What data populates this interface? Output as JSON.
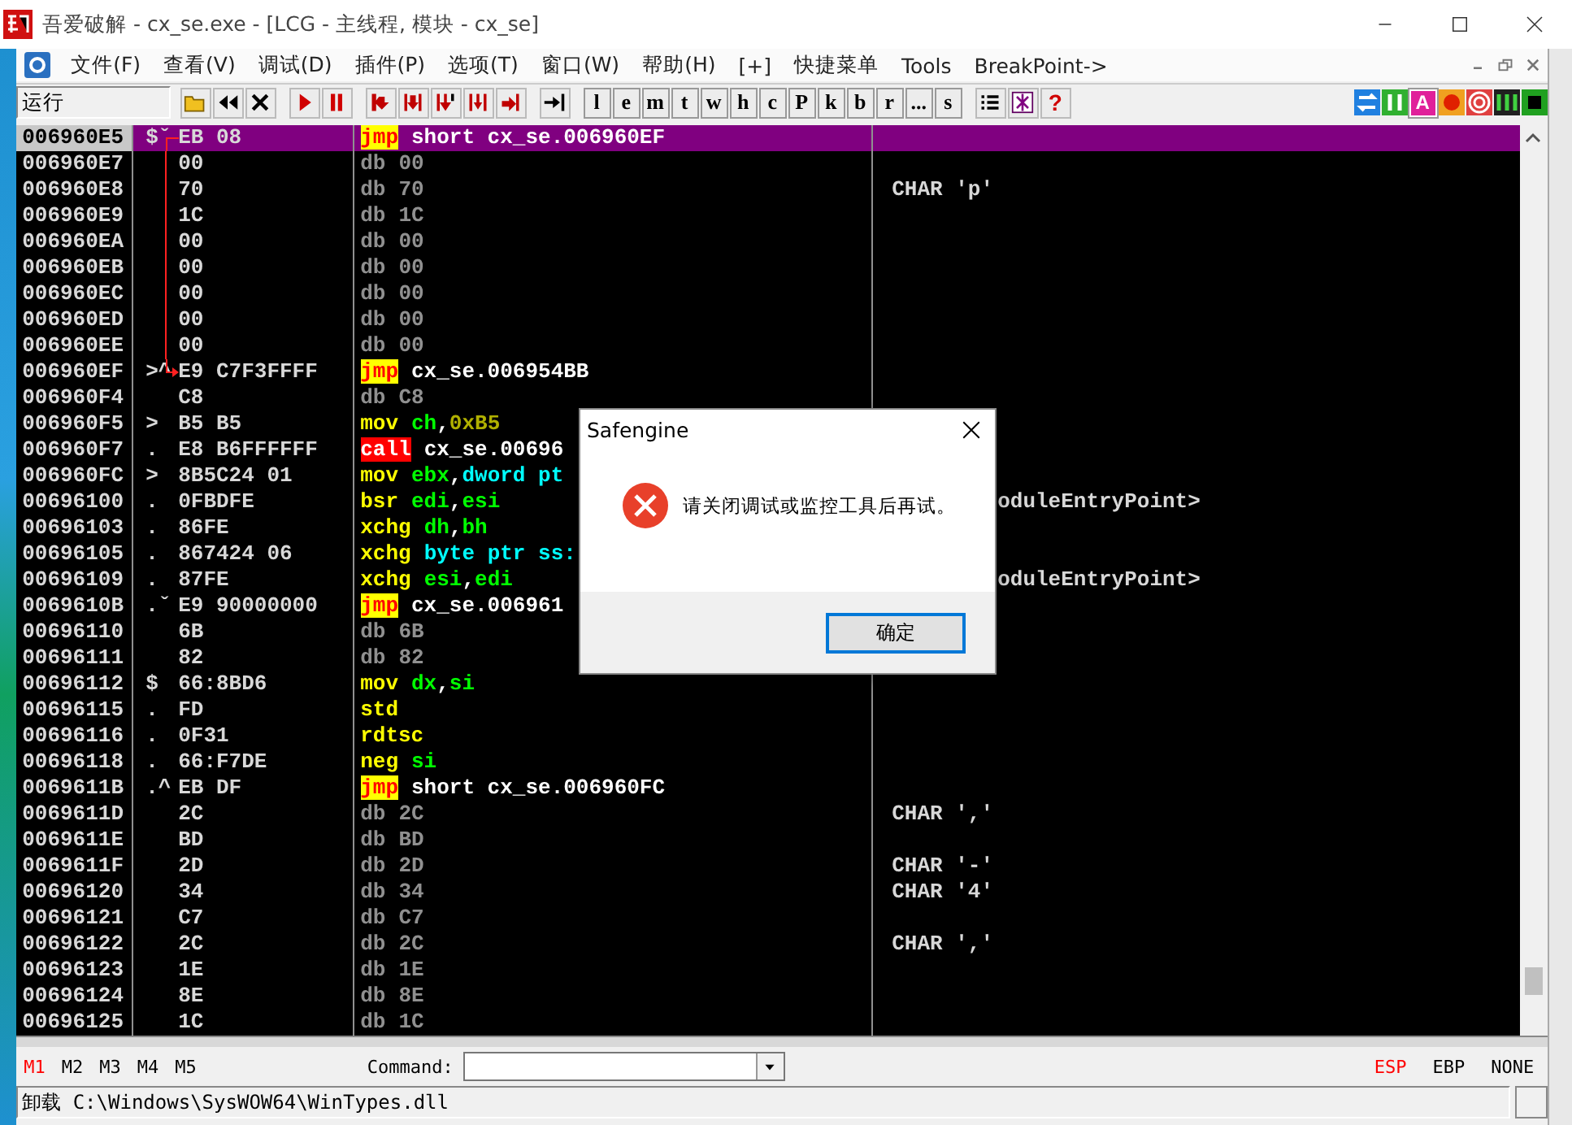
{
  "window": {
    "title": "吾爱破解 - cx_se.exe - [LCG -  主线程, 模块 - cx_se]"
  },
  "menu": [
    "文件(F)",
    "查看(V)",
    "调试(D)",
    "插件(P)",
    "选项(T)",
    "窗口(W)",
    "帮助(H)",
    "[+]",
    "快捷菜单",
    "Tools",
    "BreakPoint->"
  ],
  "toolbar": {
    "status": "运行",
    "letter_buttons": [
      "l",
      "e",
      "m",
      "t",
      "w",
      "h",
      "c",
      "P",
      "k",
      "b",
      "r",
      "...",
      "s"
    ],
    "help_button": "?",
    "letter_icon": "A"
  },
  "disassembly": {
    "rows": [
      {
        "address": "006960E5",
        "marker": "$ˇ",
        "hex": "EB 08",
        "mnemonic": {
          "text": "jmp",
          "kind": "jump"
        },
        "operands": [
          {
            "text": "short cx_se.006960EF",
            "kind": "label"
          }
        ],
        "selected": true,
        "jump": {
          "kind": "start"
        }
      },
      {
        "address": "006960E7",
        "hex": "00",
        "mnemonic": {
          "text": "db",
          "kind": "data"
        },
        "operands": [
          {
            "text": "00",
            "kind": "data"
          }
        ],
        "selected": false,
        "jump": {
          "kind": "through"
        }
      },
      {
        "address": "006960E8",
        "hex": "70",
        "mnemonic": {
          "text": "db",
          "kind": "data"
        },
        "operands": [
          {
            "text": "70",
            "kind": "data"
          }
        ],
        "comment": "CHAR 'p'",
        "selected": false,
        "jump": {
          "kind": "through"
        }
      },
      {
        "address": "006960E9",
        "hex": "1C",
        "mnemonic": {
          "text": "db",
          "kind": "data"
        },
        "operands": [
          {
            "text": "1C",
            "kind": "data"
          }
        ],
        "selected": false,
        "jump": {
          "kind": "through"
        }
      },
      {
        "address": "006960EA",
        "hex": "00",
        "mnemonic": {
          "text": "db",
          "kind": "data"
        },
        "operands": [
          {
            "text": "00",
            "kind": "data"
          }
        ],
        "selected": false,
        "jump": {
          "kind": "through"
        }
      },
      {
        "address": "006960EB",
        "hex": "00",
        "mnemonic": {
          "text": "db",
          "kind": "data"
        },
        "operands": [
          {
            "text": "00",
            "kind": "data"
          }
        ],
        "selected": false,
        "jump": {
          "kind": "through"
        }
      },
      {
        "address": "006960EC",
        "hex": "00",
        "mnemonic": {
          "text": "db",
          "kind": "data"
        },
        "operands": [
          {
            "text": "00",
            "kind": "data"
          }
        ],
        "selected": false,
        "jump": {
          "kind": "through"
        }
      },
      {
        "address": "006960ED",
        "hex": "00",
        "mnemonic": {
          "text": "db",
          "kind": "data"
        },
        "operands": [
          {
            "text": "00",
            "kind": "data"
          }
        ],
        "selected": false,
        "jump": {
          "kind": "through"
        }
      },
      {
        "address": "006960EE",
        "hex": "00",
        "mnemonic": {
          "text": "db",
          "kind": "data"
        },
        "operands": [
          {
            "text": "00",
            "kind": "data"
          }
        ],
        "selected": false,
        "jump": {
          "kind": "through"
        }
      },
      {
        "address": "006960EF",
        "marker": ">^",
        "hex": "E9 C7F3FFFF",
        "mnemonic": {
          "text": "jmp",
          "kind": "jump"
        },
        "operands": [
          {
            "text": "cx_se.006954BB",
            "kind": "label"
          }
        ],
        "selected": false,
        "jump": {
          "kind": "end"
        }
      },
      {
        "address": "006960F4",
        "hex": "C8",
        "mnemonic": {
          "text": "db",
          "kind": "data"
        },
        "operands": [
          {
            "text": "C8",
            "kind": "data"
          }
        ],
        "selected": false,
        "jump": {
          "kind": "none"
        }
      },
      {
        "address": "006960F5",
        "marker": ">",
        "hex": "B5 B5",
        "mnemonic": {
          "text": "mov",
          "kind": "op"
        },
        "operands": [
          {
            "text": "ch",
            "kind": "reg"
          },
          {
            "text": ",",
            "kind": "punct"
          },
          {
            "text": "0xB5",
            "kind": "imm"
          }
        ],
        "selected": false,
        "jump": {
          "kind": "none"
        }
      },
      {
        "address": "006960F7",
        "marker": ".",
        "hex": "E8 B6FFFFFF",
        "mnemonic": {
          "text": "call",
          "kind": "call"
        },
        "operands": [
          {
            "text": "cx_se.00696",
            "kind": "label"
          }
        ],
        "selected": false,
        "jump": {
          "kind": "none"
        }
      },
      {
        "address": "006960FC",
        "marker": ">",
        "hex": "8B5C24 01",
        "mnemonic": {
          "text": "mov",
          "kind": "op"
        },
        "operands": [
          {
            "text": "ebx",
            "kind": "reg"
          },
          {
            "text": ",",
            "kind": "punct"
          },
          {
            "text": "dword pt",
            "kind": "mem"
          }
        ],
        "selected": false,
        "jump": {
          "kind": "none"
        }
      },
      {
        "address": "00696100",
        "marker": ".",
        "hex": "0FBDFE",
        "mnemonic": {
          "text": "bsr",
          "kind": "op"
        },
        "operands": [
          {
            "text": "edi",
            "kind": "reg"
          },
          {
            "text": ",",
            "kind": "punct"
          },
          {
            "text": "esi",
            "kind": "reg"
          }
        ],
        "comment": "oduleEntryPoint>",
        "covered": true,
        "selected": false,
        "jump": {
          "kind": "none"
        }
      },
      {
        "address": "00696103",
        "marker": ".",
        "hex": "86FE",
        "mnemonic": {
          "text": "xchg",
          "kind": "op"
        },
        "operands": [
          {
            "text": "dh",
            "kind": "reg"
          },
          {
            "text": ",",
            "kind": "punct"
          },
          {
            "text": "bh",
            "kind": "reg"
          }
        ],
        "selected": false,
        "jump": {
          "kind": "none"
        }
      },
      {
        "address": "00696105",
        "marker": ".",
        "hex": "867424 06",
        "mnemonic": {
          "text": "xchg",
          "kind": "op"
        },
        "operands": [
          {
            "text": "byte ptr ss:",
            "kind": "mem"
          }
        ],
        "selected": false,
        "jump": {
          "kind": "none"
        }
      },
      {
        "address": "00696109",
        "marker": ".",
        "hex": "87FE",
        "mnemonic": {
          "text": "xchg",
          "kind": "op"
        },
        "operands": [
          {
            "text": "esi",
            "kind": "reg"
          },
          {
            "text": ",",
            "kind": "punct"
          },
          {
            "text": "edi",
            "kind": "reg"
          }
        ],
        "comment": "oduleEntryPoint>",
        "covered": true,
        "selected": false,
        "jump": {
          "kind": "none"
        }
      },
      {
        "address": "0069610B",
        "marker": ".ˇ",
        "hex": "E9 90000000",
        "mnemonic": {
          "text": "jmp",
          "kind": "jump"
        },
        "operands": [
          {
            "text": "cx_se.006961",
            "kind": "label"
          }
        ],
        "selected": false,
        "jump": {
          "kind": "none"
        }
      },
      {
        "address": "00696110",
        "hex": "6B",
        "mnemonic": {
          "text": "db",
          "kind": "data"
        },
        "operands": [
          {
            "text": "6B",
            "kind": "data"
          }
        ],
        "selected": false,
        "jump": {
          "kind": "none"
        }
      },
      {
        "address": "00696111",
        "hex": "82",
        "mnemonic": {
          "text": "db",
          "kind": "data"
        },
        "operands": [
          {
            "text": "82",
            "kind": "data"
          }
        ],
        "selected": false,
        "jump": {
          "kind": "none"
        }
      },
      {
        "address": "00696112",
        "marker": "$",
        "hex": "66:8BD6",
        "mnemonic": {
          "text": "mov",
          "kind": "op"
        },
        "operands": [
          {
            "text": "dx",
            "kind": "reg"
          },
          {
            "text": ",",
            "kind": "punct"
          },
          {
            "text": "si",
            "kind": "reg"
          }
        ],
        "selected": false,
        "jump": {
          "kind": "none"
        }
      },
      {
        "address": "00696115",
        "marker": ".",
        "hex": "FD",
        "mnemonic": {
          "text": "std",
          "kind": "op"
        },
        "operands": [],
        "selected": false,
        "jump": {
          "kind": "none"
        }
      },
      {
        "address": "00696116",
        "marker": ".",
        "hex": "0F31",
        "mnemonic": {
          "text": "rdtsc",
          "kind": "op"
        },
        "operands": [],
        "selected": false,
        "jump": {
          "kind": "none"
        }
      },
      {
        "address": "00696118",
        "marker": ".",
        "hex": "66:F7DE",
        "mnemonic": {
          "text": "neg",
          "kind": "op"
        },
        "operands": [
          {
            "text": "si",
            "kind": "reg"
          }
        ],
        "selected": false,
        "jump": {
          "kind": "none"
        }
      },
      {
        "address": "0069611B",
        "marker": ".^",
        "hex": "EB DF",
        "mnemonic": {
          "text": "jmp",
          "kind": "jump"
        },
        "operands": [
          {
            "text": "short cx_se.006960FC",
            "kind": "label"
          }
        ],
        "selected": false,
        "jump": {
          "kind": "none"
        }
      },
      {
        "address": "0069611D",
        "hex": "2C",
        "mnemonic": {
          "text": "db",
          "kind": "data"
        },
        "operands": [
          {
            "text": "2C",
            "kind": "data"
          }
        ],
        "comment": "CHAR ','",
        "selected": false,
        "jump": {
          "kind": "none"
        }
      },
      {
        "address": "0069611E",
        "hex": "BD",
        "mnemonic": {
          "text": "db",
          "kind": "data"
        },
        "operands": [
          {
            "text": "BD",
            "kind": "data"
          }
        ],
        "selected": false,
        "jump": {
          "kind": "none"
        }
      },
      {
        "address": "0069611F",
        "hex": "2D",
        "mnemonic": {
          "text": "db",
          "kind": "data"
        },
        "operands": [
          {
            "text": "2D",
            "kind": "data"
          }
        ],
        "comment": "CHAR '-'",
        "selected": false,
        "jump": {
          "kind": "none"
        }
      },
      {
        "address": "00696120",
        "hex": "34",
        "mnemonic": {
          "text": "db",
          "kind": "data"
        },
        "operands": [
          {
            "text": "34",
            "kind": "data"
          }
        ],
        "comment": "CHAR '4'",
        "selected": false,
        "jump": {
          "kind": "none"
        }
      },
      {
        "address": "00696121",
        "hex": "C7",
        "mnemonic": {
          "text": "db",
          "kind": "data"
        },
        "operands": [
          {
            "text": "C7",
            "kind": "data"
          }
        ],
        "selected": false,
        "jump": {
          "kind": "none"
        }
      },
      {
        "address": "00696122",
        "hex": "2C",
        "mnemonic": {
          "text": "db",
          "kind": "data"
        },
        "operands": [
          {
            "text": "2C",
            "kind": "data"
          }
        ],
        "comment": "CHAR ','",
        "selected": false,
        "jump": {
          "kind": "none"
        }
      },
      {
        "address": "00696123",
        "hex": "1E",
        "mnemonic": {
          "text": "db",
          "kind": "data"
        },
        "operands": [
          {
            "text": "1E",
            "kind": "data"
          }
        ],
        "selected": false,
        "jump": {
          "kind": "none"
        }
      },
      {
        "address": "00696124",
        "hex": "8E",
        "mnemonic": {
          "text": "db",
          "kind": "data"
        },
        "operands": [
          {
            "text": "8E",
            "kind": "data"
          }
        ],
        "selected": false,
        "jump": {
          "kind": "none"
        }
      },
      {
        "address": "00696125",
        "hex": "1C",
        "mnemonic": {
          "text": "db",
          "kind": "data"
        },
        "operands": [
          {
            "text": "1C",
            "kind": "data"
          }
        ],
        "selected": false,
        "jump": {
          "kind": "none"
        }
      }
    ]
  },
  "dialog": {
    "title": "Safengine",
    "message": "请关闭调试或监控工具后再试。",
    "button": "确定"
  },
  "memory_tabs": [
    {
      "label": "M1",
      "selected": true
    },
    {
      "label": "M2",
      "selected": false
    },
    {
      "label": "M3",
      "selected": false
    },
    {
      "label": "M4",
      "selected": false
    },
    {
      "label": "M5",
      "selected": false
    }
  ],
  "command": {
    "label": "Command:"
  },
  "registers": [
    {
      "label": "ESP",
      "selected": true
    },
    {
      "label": "EBP",
      "selected": false
    },
    {
      "label": "NONE",
      "selected": false
    }
  ],
  "status_bar": "卸载 C:\\Windows\\SysWOW64\\WinTypes.dll"
}
